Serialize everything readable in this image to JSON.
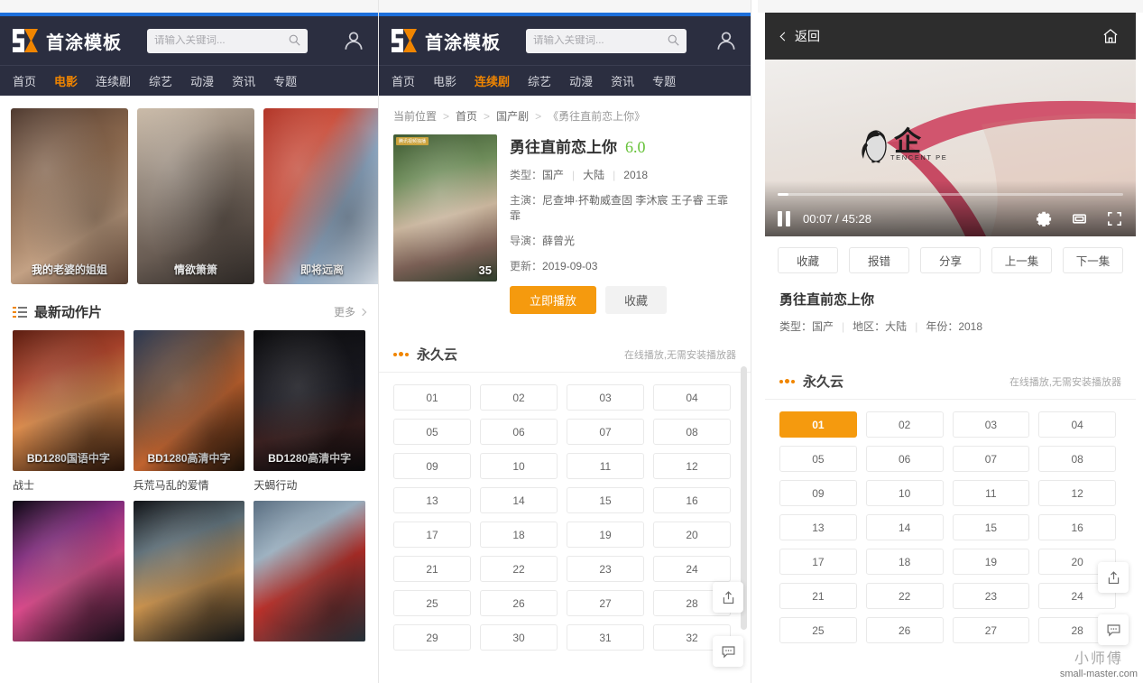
{
  "site": {
    "logo_text": "首涂模板",
    "search_placeholder": "请输入关键词...",
    "nav": [
      "首页",
      "电影",
      "连续剧",
      "综艺",
      "动漫",
      "资讯",
      "专题"
    ],
    "accent": "#f08500",
    "header_bg": "#2b2e40",
    "topbar_bg": "#1d6fdb"
  },
  "left": {
    "active_nav": "电影",
    "carousel": [
      {
        "caption": "我的老婆的姐姐"
      },
      {
        "caption": "情欲箫箫"
      },
      {
        "caption": "即将远离"
      }
    ],
    "section": {
      "title": "最新动作片",
      "more": "更多"
    },
    "videos": [
      {
        "badge": "BD1280国语中字",
        "name": "战士"
      },
      {
        "badge": "BD1280高清中字",
        "name": "兵荒马乱的爱情"
      },
      {
        "badge": "BD1280高清中字",
        "name": "天蝎行动"
      },
      {
        "badge": "",
        "name": ""
      },
      {
        "badge": "",
        "name": ""
      },
      {
        "badge": "",
        "name": ""
      }
    ]
  },
  "mid": {
    "active_nav": "连续剧",
    "breadcrumb": {
      "label": "当前位置",
      "items": [
        "首页",
        "国产剧",
        "《勇往直前恋上你》"
      ]
    },
    "detail": {
      "poster_badge": "35",
      "poster_tag": "腾讯视频独播",
      "title": "勇往直前恋上你",
      "score": "6.0",
      "type_label": "类型：",
      "type_value": "国产",
      "region": "大陆",
      "year": "2018",
      "actors_label": "主演：",
      "actors": "尼查坤·抔勒威查固 李沐宸 王子睿 王霏霏",
      "director_label": "导演：",
      "director": "薛曾光",
      "update_label": "更新：",
      "update": "2019-09-03",
      "play_button": "立即播放",
      "fav_button": "收藏"
    },
    "source": {
      "name": "永久云",
      "note": "在线播放,无需安装播放器"
    },
    "episodes": [
      "01",
      "02",
      "03",
      "04",
      "05",
      "06",
      "07",
      "08",
      "09",
      "10",
      "11",
      "12",
      "13",
      "14",
      "15",
      "16",
      "17",
      "18",
      "19",
      "20",
      "21",
      "22",
      "23",
      "24",
      "25",
      "26",
      "27",
      "28",
      "29",
      "30",
      "31",
      "32"
    ],
    "active_episode": null
  },
  "right": {
    "back_label": "返回",
    "player": {
      "logo_cn": "企",
      "logo_en": "TENCENT PE",
      "current_time": "00:07",
      "duration": "45:28",
      "separator": "/",
      "progress_percent": 3.2
    },
    "buttons": [
      "收藏",
      "报错",
      "分享",
      "上一集",
      "下一集"
    ],
    "title": "勇往直前恋上你",
    "meta": {
      "type_label": "类型：",
      "type_value": "国产",
      "region_label": "地区：",
      "region_value": "大陆",
      "year_label": "年份：",
      "year_value": "2018"
    },
    "source": {
      "name": "永久云",
      "note": "在线播放,无需安装播放器"
    },
    "episodes": [
      "01",
      "02",
      "03",
      "04",
      "05",
      "06",
      "07",
      "08",
      "09",
      "10",
      "11",
      "12",
      "13",
      "14",
      "15",
      "16",
      "17",
      "18",
      "19",
      "20",
      "21",
      "22",
      "23",
      "24",
      "25",
      "26",
      "27",
      "28"
    ],
    "active_episode": "01"
  },
  "watermark": {
    "cn": "小师傅",
    "url": "small-master.com"
  }
}
